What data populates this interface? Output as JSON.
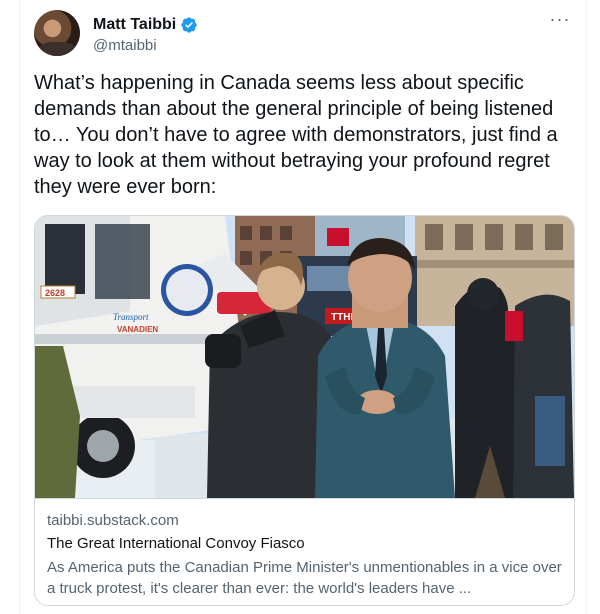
{
  "author": {
    "name": "Matt Taibbi",
    "handle": "@mtaibbi",
    "verified": true
  },
  "more_icon": "more-horizontal-icon",
  "tweet": {
    "text": "What’s happening in Canada seems less about specific demands than about the general principle of being listened to… You don’t have to agree with demonstrators, just find a way to look at them without betraying your profound regret they were ever born:"
  },
  "card": {
    "domain": "taibbi.substack.com",
    "title": "The Great International Convoy Fiasco",
    "description": "As America puts the Canadian Prime Minister's unmentionables in a vice over a truck protest, it's clearer than ever: the world's leaders have ...",
    "image": {
      "truck_text_1": "Transport",
      "truck_text_2": "VANADIEN",
      "truck_number": "2628",
      "megaphone_text": "",
      "sign_text": "TTHE FUCK"
    }
  },
  "colors": {
    "verified": "#1d9bf0",
    "text_primary": "#0f1419",
    "text_secondary": "#536471",
    "border": "#cfd9de"
  }
}
